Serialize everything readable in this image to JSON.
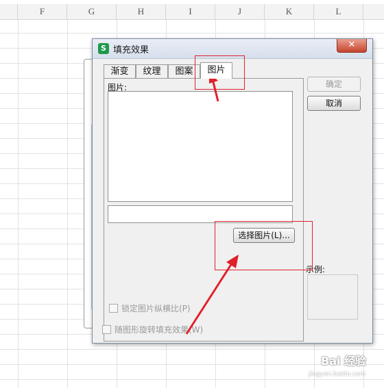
{
  "spreadsheet": {
    "columns": [
      "F",
      "G",
      "H",
      "I",
      "J",
      "K",
      "L"
    ]
  },
  "dialog": {
    "title": "填充效果",
    "app_icon_letter": "S",
    "close_symbol": "✕",
    "tabs": [
      {
        "label": "渐变",
        "active": false
      },
      {
        "label": "纹理",
        "active": false
      },
      {
        "label": "图案",
        "active": false
      },
      {
        "label": "图片",
        "active": true
      }
    ],
    "picture_label": "图片:",
    "file_path_value": "",
    "select_button_label": "选择图片(L)...",
    "lock_ratio_label": "锁定图片纵横比(P)",
    "rotate_label": "随图形旋转填充效果(W)",
    "ok_label": "确定",
    "cancel_label": "取消",
    "sample_label": "示例:",
    "ok_disabled": true
  },
  "annotation": {
    "highlight_color": "#e0202a"
  },
  "watermark": {
    "text": "Bai 经验",
    "url": "jingyan.baidu.com"
  }
}
